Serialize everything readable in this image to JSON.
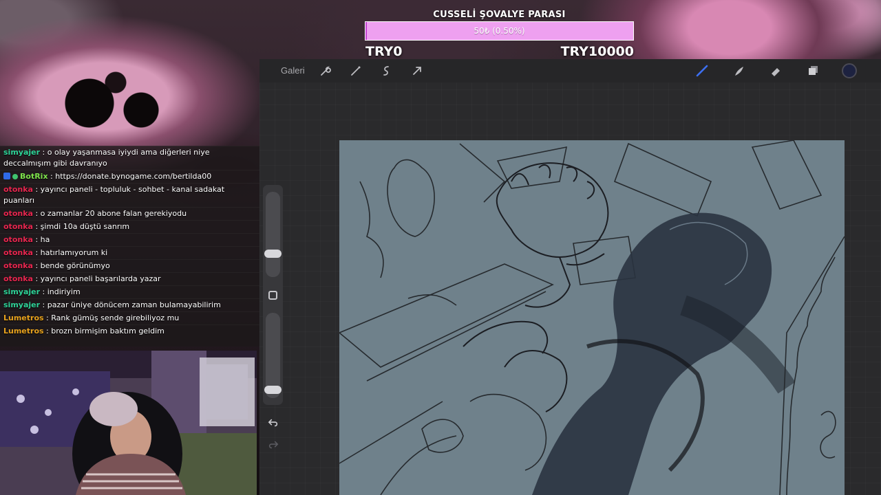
{
  "goal": {
    "title": "CUSSELİ ŞOVALYE PARASI",
    "progress_text": "50₺ (0.50%)",
    "progress_fraction": 0.005,
    "min_label": "TRY0",
    "max_label": "TRY10000",
    "bar_color": "#eea0f0",
    "fill_color": "#c23fd0"
  },
  "app": {
    "gallery_label": "Galeri",
    "left_tools": [
      "wrench-icon",
      "magic-wand-icon",
      "selection-icon",
      "transform-arrow-icon"
    ],
    "right_tools": [
      "brush-icon",
      "smudge-icon",
      "eraser-icon",
      "layers-icon"
    ],
    "current_color": "#1d2240",
    "side_panel": {
      "brush_size_level": 0.25,
      "opacity_level": 0.05
    }
  },
  "chat": {
    "messages": [
      {
        "user": "simyajer",
        "color": "#2fd398",
        "text": "o olay yaşanmasa iyiydi ama diğerleri niye deccalmışım gibi davranıyo"
      },
      {
        "user": "BotRix",
        "color": "#7ee24c",
        "text": "https://donate.bynogame.com/bertilda00",
        "badges": true
      },
      {
        "user": "otonka",
        "color": "#e8264f",
        "text": "yayıncı paneli - topluluk - sohbet - kanal sadakat puanları"
      },
      {
        "user": "otonka",
        "color": "#e8264f",
        "text": "o zamanlar 20 abone falan gerekiyodu"
      },
      {
        "user": "otonka",
        "color": "#e8264f",
        "text": "şimdi 10a düştü sanrım"
      },
      {
        "user": "otonka",
        "color": "#e8264f",
        "text": "ha"
      },
      {
        "user": "otonka",
        "color": "#e8264f",
        "text": "hatırlamıyorum ki"
      },
      {
        "user": "otonka",
        "color": "#e8264f",
        "text": "bende görünümyo"
      },
      {
        "user": "otonka",
        "color": "#e8264f",
        "text": "yayıncı paneli başarılarda yazar"
      },
      {
        "user": "simyajer",
        "color": "#2fd398",
        "text": "indiriyim"
      },
      {
        "user": "simyajer",
        "color": "#2fd398",
        "text": "pazar üniye dönücem zaman bulamayabilirim"
      },
      {
        "user": "Lumetros",
        "color": "#e7a21d",
        "text": "Rank gümüş sende girebiliyoz mu"
      },
      {
        "user": "Lumetros",
        "color": "#e7a21d",
        "text": "brozn birmişim baktım geldim"
      }
    ]
  }
}
